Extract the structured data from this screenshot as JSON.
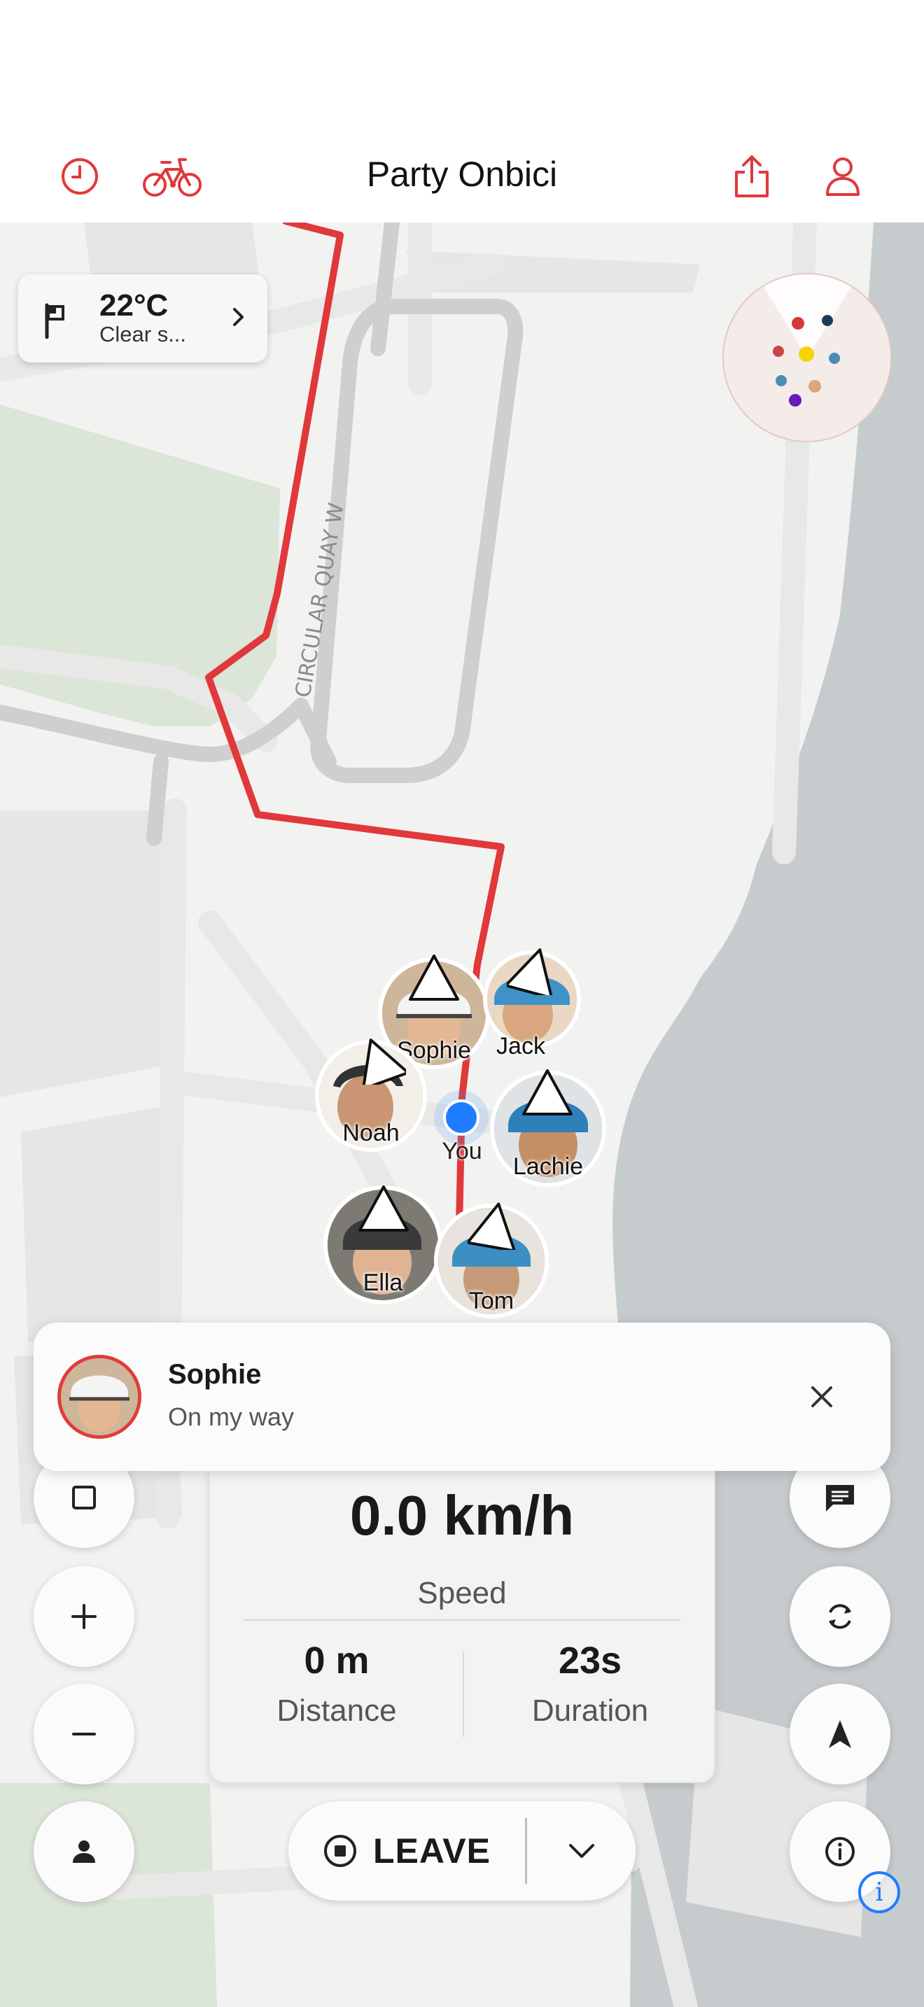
{
  "header": {
    "title": "Party Onbici",
    "history_icon": "clock-icon",
    "bike_icon": "bicycle-icon",
    "share_icon": "share-icon",
    "profile_icon": "person-icon",
    "accent_color": "#e0383b"
  },
  "weather": {
    "temperature": "22°C",
    "condition": "Clear s...",
    "icon": "flag-icon",
    "chevron_icon": "chevron-right-icon"
  },
  "map": {
    "street_label": "CIRCULAR QUAY W",
    "route_color": "#e0383b",
    "water_color": "#c6cbcd",
    "park_color": "#dbe5d8"
  },
  "radar": {
    "dots": [
      "#d33a3a",
      "#1f3b5c",
      "#c94545",
      "#f7d300",
      "#4a8cb5",
      "#4a8cb5",
      "#d8a77a",
      "#6a18b8"
    ]
  },
  "riders": [
    {
      "name": "Sophie"
    },
    {
      "name": "Jack"
    },
    {
      "name": "Noah"
    },
    {
      "name": "Lachie"
    },
    {
      "name": "Ella"
    },
    {
      "name": "Tom"
    }
  ],
  "you_label": "You",
  "notification": {
    "name": "Sophie",
    "message": "On my way",
    "close_icon": "close-icon"
  },
  "stats": {
    "speed_value": "0.0 km/h",
    "speed_label": "Speed",
    "distance_value": "0 m",
    "distance_label": "Distance",
    "duration_value": "23s",
    "duration_label": "Duration"
  },
  "controls": {
    "left": [
      "square-icon",
      "plus-icon",
      "minus-icon",
      "person-icon"
    ],
    "right": [
      "chat-icon",
      "sync-icon",
      "navigation-arrow-icon",
      "info-icon"
    ]
  },
  "leave_button": {
    "label": "LEAVE",
    "icon": "stop-circle-icon",
    "dropdown_icon": "chevron-down-icon"
  },
  "info_badge": "i"
}
